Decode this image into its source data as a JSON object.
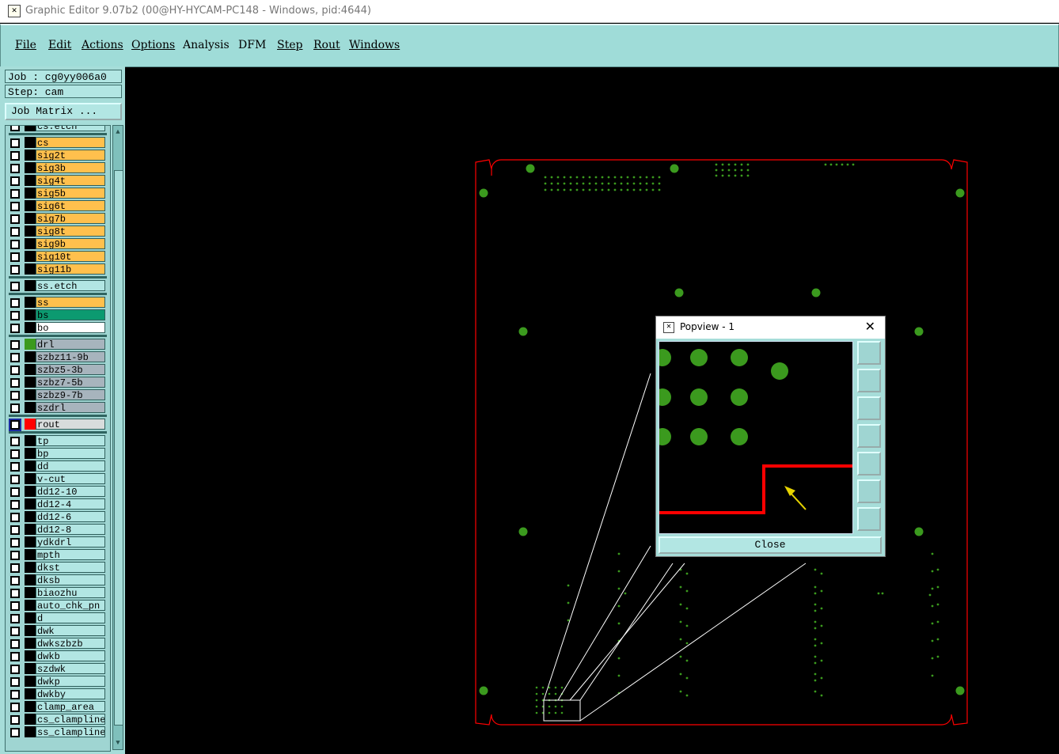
{
  "window": {
    "title": "Graphic Editor 9.07b2 (00@HY-HYCAM-PC148 - Windows, pid:4644)"
  },
  "menu": [
    "File",
    "Edit",
    "Actions",
    "Options",
    "Analysis",
    "DFM",
    "Step",
    "Rout",
    "Windows"
  ],
  "job": {
    "job_label": "Job : cg0yy006a0",
    "step_label": "Step: cam",
    "job_matrix": "Job Matrix ..."
  },
  "layers": [
    {
      "name": "cs.etch",
      "color": "#b2e6e3",
      "swatch": "#000000"
    },
    {
      "name": "cs",
      "color": "#ffc04d",
      "swatch": "#000000"
    },
    {
      "name": "sig2t",
      "color": "#ffc04d",
      "swatch": "#000000"
    },
    {
      "name": "sig3b",
      "color": "#ffc04d",
      "swatch": "#000000"
    },
    {
      "name": "sig4t",
      "color": "#ffc04d",
      "swatch": "#000000"
    },
    {
      "name": "sig5b",
      "color": "#ffc04d",
      "swatch": "#000000"
    },
    {
      "name": "sig6t",
      "color": "#ffc04d",
      "swatch": "#000000"
    },
    {
      "name": "sig7b",
      "color": "#ffc04d",
      "swatch": "#000000"
    },
    {
      "name": "sig8t",
      "color": "#ffc04d",
      "swatch": "#000000"
    },
    {
      "name": "sig9b",
      "color": "#ffc04d",
      "swatch": "#000000"
    },
    {
      "name": "sig10t",
      "color": "#ffc04d",
      "swatch": "#000000"
    },
    {
      "name": "sig11b",
      "color": "#ffc04d",
      "swatch": "#000000"
    },
    {
      "name": "ss.etch",
      "color": "#b2e6e3",
      "swatch": "#000000"
    },
    {
      "name": "ss",
      "color": "#ffc04d",
      "swatch": "#000000"
    },
    {
      "name": "bs",
      "color": "#0c9a70",
      "swatch": "#000000"
    },
    {
      "name": "bo",
      "color": "#ffffff",
      "swatch": "#000000"
    },
    {
      "name": "drl",
      "color": "#a7b4bd",
      "swatch": "#3b9a1e"
    },
    {
      "name": "szbz11-9b",
      "color": "#a7b4bd",
      "swatch": "#000000"
    },
    {
      "name": "szbz5-3b",
      "color": "#a7b4bd",
      "swatch": "#000000"
    },
    {
      "name": "szbz7-5b",
      "color": "#a7b4bd",
      "swatch": "#000000"
    },
    {
      "name": "szbz9-7b",
      "color": "#a7b4bd",
      "swatch": "#000000"
    },
    {
      "name": "szdrl",
      "color": "#a7b4bd",
      "swatch": "#000000"
    },
    {
      "name": "rout",
      "color": "#d8dcdc",
      "swatch": "#ff0000"
    },
    {
      "name": "tp",
      "color": "#b2e6e3",
      "swatch": "#000000"
    },
    {
      "name": "bp",
      "color": "#b2e6e3",
      "swatch": "#000000"
    },
    {
      "name": "dd",
      "color": "#b2e6e3",
      "swatch": "#000000"
    },
    {
      "name": "v-cut",
      "color": "#b2e6e3",
      "swatch": "#000000"
    },
    {
      "name": "dd12-10",
      "color": "#b2e6e3",
      "swatch": "#000000"
    },
    {
      "name": "dd12-4",
      "color": "#b2e6e3",
      "swatch": "#000000"
    },
    {
      "name": "dd12-6",
      "color": "#b2e6e3",
      "swatch": "#000000"
    },
    {
      "name": "dd12-8",
      "color": "#b2e6e3",
      "swatch": "#000000"
    },
    {
      "name": "ydkdrl",
      "color": "#b2e6e3",
      "swatch": "#000000"
    },
    {
      "name": "mpth",
      "color": "#b2e6e3",
      "swatch": "#000000"
    },
    {
      "name": "dkst",
      "color": "#b2e6e3",
      "swatch": "#000000"
    },
    {
      "name": "dksb",
      "color": "#b2e6e3",
      "swatch": "#000000"
    },
    {
      "name": "biaozhu",
      "color": "#b2e6e3",
      "swatch": "#000000"
    },
    {
      "name": "auto_chk_pn",
      "color": "#b2e6e3",
      "swatch": "#000000"
    },
    {
      "name": "d",
      "color": "#b2e6e3",
      "swatch": "#000000"
    },
    {
      "name": "dwk",
      "color": "#b2e6e3",
      "swatch": "#000000"
    },
    {
      "name": "dwkszbzb",
      "color": "#b2e6e3",
      "swatch": "#000000"
    },
    {
      "name": "dwkb",
      "color": "#b2e6e3",
      "swatch": "#000000"
    },
    {
      "name": "szdwk",
      "color": "#b2e6e3",
      "swatch": "#000000"
    },
    {
      "name": "dwkp",
      "color": "#b2e6e3",
      "swatch": "#000000"
    },
    {
      "name": "dwkby",
      "color": "#b2e6e3",
      "swatch": "#000000"
    },
    {
      "name": "clamp_area",
      "color": "#b2e6e3",
      "swatch": "#000000"
    },
    {
      "name": "cs_clampline",
      "color": "#b2e6e3",
      "swatch": "#000000"
    },
    {
      "name": "ss_clampline",
      "color": "#b2e6e3",
      "swatch": "#000000"
    }
  ],
  "popview": {
    "title": "Popview - 1",
    "close_label": "Close"
  },
  "colors": {
    "board_outline": "#ff0000",
    "pad": "#3b9a1e",
    "menu_bg": "#9fdcd8"
  }
}
